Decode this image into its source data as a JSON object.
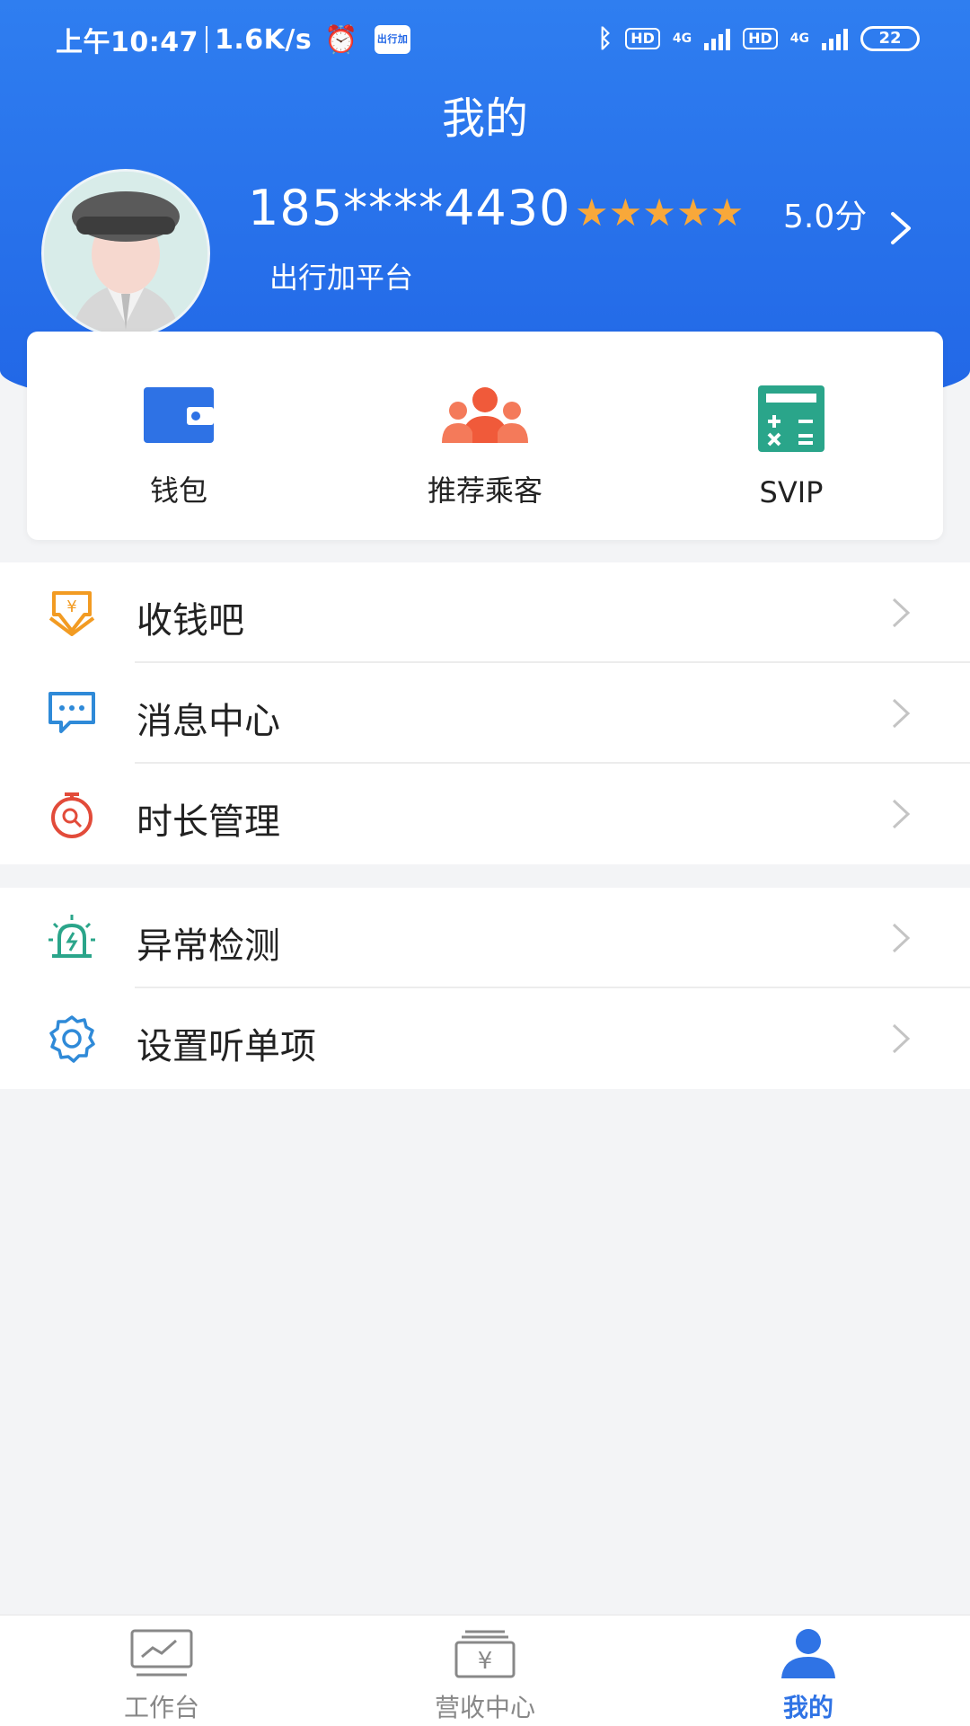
{
  "status_bar": {
    "time": "上午10:47",
    "speed": "1.6K/s",
    "app_badge": "出行加",
    "hd1": "HD",
    "hd2": "HD",
    "net1": "4G",
    "net2": "4G",
    "battery": "22"
  },
  "page_title": "我的",
  "profile": {
    "phone": "185****4430",
    "stars": "★★★★★",
    "rating": "5.0分",
    "platform": "出行加平台"
  },
  "quick_actions": [
    {
      "label": "钱包",
      "icon": "wallet-icon"
    },
    {
      "label": "推荐乘客",
      "icon": "users-icon"
    },
    {
      "label": "SVIP",
      "icon": "calculator-icon"
    }
  ],
  "menu_group_1": [
    {
      "label": "收钱吧",
      "icon": "yuan-receive-icon"
    },
    {
      "label": "消息中心",
      "icon": "message-icon"
    },
    {
      "label": "时长管理",
      "icon": "timer-icon"
    }
  ],
  "menu_group_2": [
    {
      "label": "异常检测",
      "icon": "alarm-light-icon"
    },
    {
      "label": "设置听单项",
      "icon": "gear-icon"
    }
  ],
  "tab_bar": [
    {
      "label": "工作台",
      "icon": "chart-monitor-icon"
    },
    {
      "label": "营收中心",
      "icon": "yuan-box-icon"
    },
    {
      "label": "我的",
      "icon": "person-icon"
    }
  ],
  "colors": {
    "header": "#2166e6",
    "accent": "#2f73e5",
    "star": "#f8a83a",
    "wallet": "#2e72e5",
    "users": "#f05a3a",
    "svip": "#2aa58a"
  }
}
